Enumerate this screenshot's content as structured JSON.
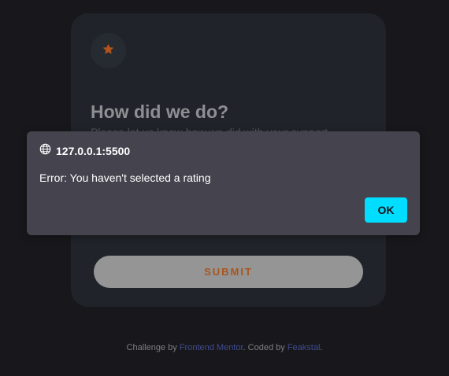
{
  "card": {
    "icon": "star-icon",
    "title": "How did we do?",
    "description": "Please let us know how we did with your support",
    "submit_label": "SUBMIT"
  },
  "dialog": {
    "origin": "127.0.0.1:5500",
    "origin_icon": "globe-icon",
    "message": "Error: You haven't selected a rating",
    "ok_label": "OK"
  },
  "footer": {
    "prefix": "Challenge by ",
    "challenge_link": "Frontend Mentor",
    "middle": ". Coded by ",
    "author_link": "Feakstal",
    "suffix": "."
  },
  "colors": {
    "background": "#18181c",
    "card": "#20232a",
    "accent_orange": "#a8561e",
    "dialog": "#45434d",
    "ok_button": "#00ddff"
  }
}
